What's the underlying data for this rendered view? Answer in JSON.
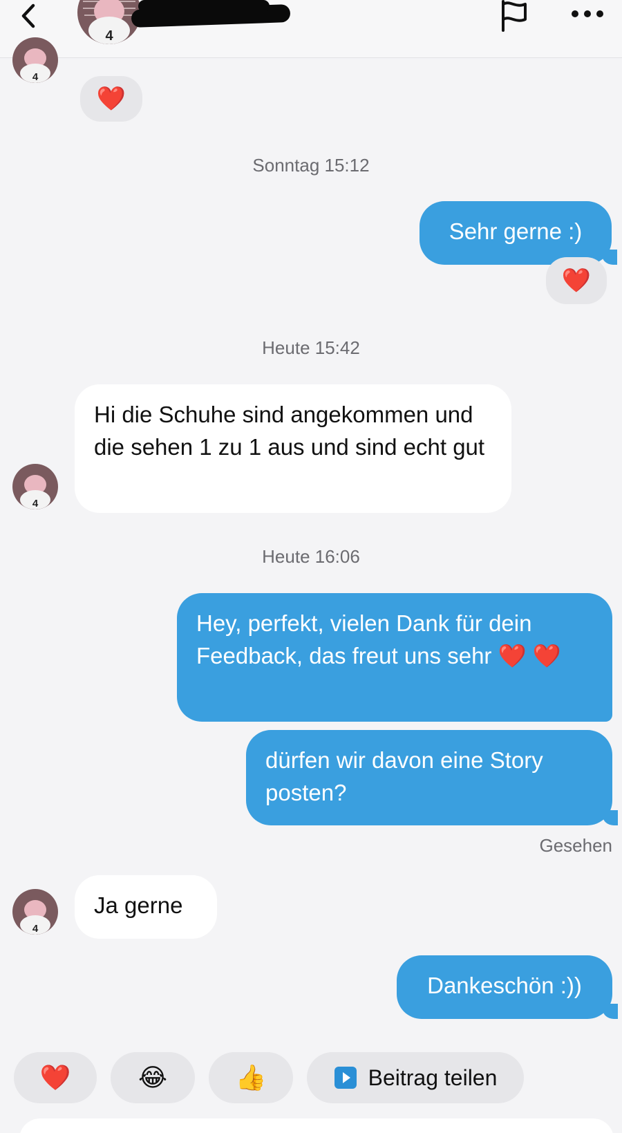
{
  "header": {
    "back_icon": "chevron-left-icon",
    "avatar_badge": "4",
    "flag_icon": "flag-icon",
    "more_icon": "more-horizontal-icon"
  },
  "colors": {
    "outgoing": "#3a9fdf",
    "incoming": "#ffffff",
    "background": "#f4f4f6",
    "reaction_bg": "#e6e6e9"
  },
  "avatar_badge": "4",
  "conversation": {
    "top_reaction": "❤️",
    "timestamp_1": "Sonntag 15:12",
    "msg_sehr_gerne": "Sehr gerne :)",
    "reaction_sehr_gerne": "❤️",
    "timestamp_2": "Heute 15:42",
    "msg_schuhe": "Hi die Schuhe sind angekommen und die sehen 1 zu 1 aus und sind echt gut",
    "timestamp_3": "Heute 16:06",
    "msg_feedback": "Hey, perfekt, vielen Dank für dein Feedback, das freut uns sehr ❤️ ❤️",
    "msg_story": "dürfen wir davon eine Story posten?",
    "seen_label": "Gesehen",
    "msg_ja_gerne": "Ja gerne",
    "msg_dankeschoen": "Dankeschön :))"
  },
  "quick_replies": {
    "heart": "❤️",
    "laugh": "😂",
    "thumbs_up": "👍",
    "share_label": "Beitrag teilen",
    "share_icon": "play-square-icon"
  }
}
